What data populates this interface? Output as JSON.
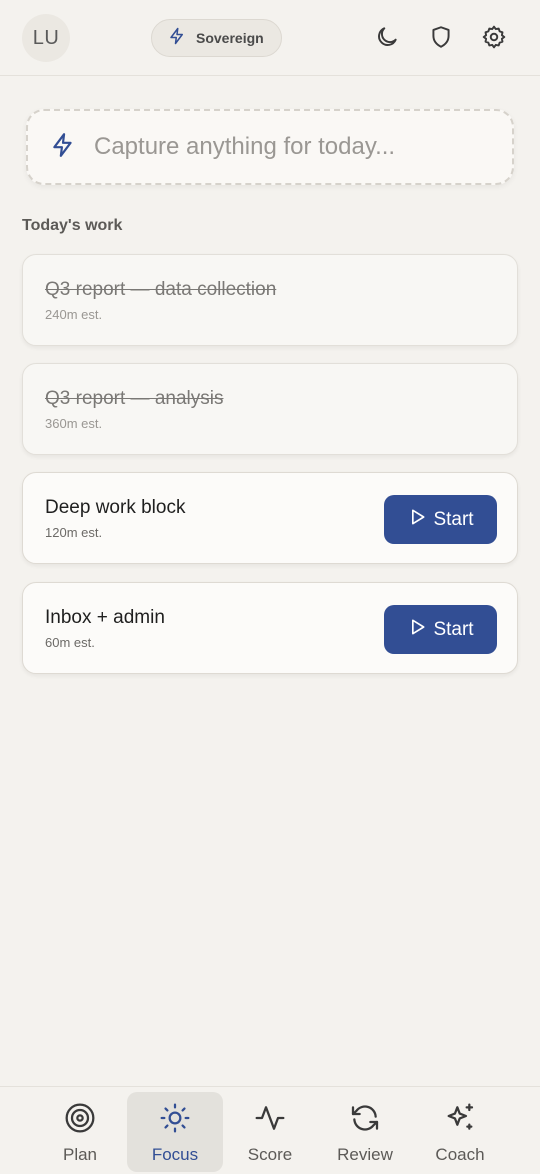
{
  "header": {
    "avatar_initials": "LU",
    "mode_label": "Sovereign",
    "icons": [
      "lightning-icon",
      "moon-icon",
      "shield-icon",
      "gear-icon"
    ]
  },
  "capture": {
    "placeholder": "Capture anything for today...",
    "value": ""
  },
  "section_title": "Today's work",
  "tasks": [
    {
      "title": "Q3 report — data collection",
      "estimate": "240m est.",
      "done": true
    },
    {
      "title": "Q3 report — analysis",
      "estimate": "360m est.",
      "done": true
    },
    {
      "title": "Deep work block",
      "estimate": "120m est.",
      "done": false,
      "action": "Start"
    },
    {
      "title": "Inbox + admin",
      "estimate": "60m est.",
      "done": false,
      "action": "Start"
    }
  ],
  "nav": {
    "items": [
      {
        "label": "Plan",
        "icon": "target-icon"
      },
      {
        "label": "Focus",
        "icon": "sun-icon",
        "active": true
      },
      {
        "label": "Score",
        "icon": "activity-icon"
      },
      {
        "label": "Review",
        "icon": "refresh-icon"
      },
      {
        "label": "Coach",
        "icon": "sparkles-icon"
      }
    ]
  },
  "colors": {
    "accent": "#324e94",
    "background": "#f4f2ee",
    "card": "#fcfbf9"
  }
}
